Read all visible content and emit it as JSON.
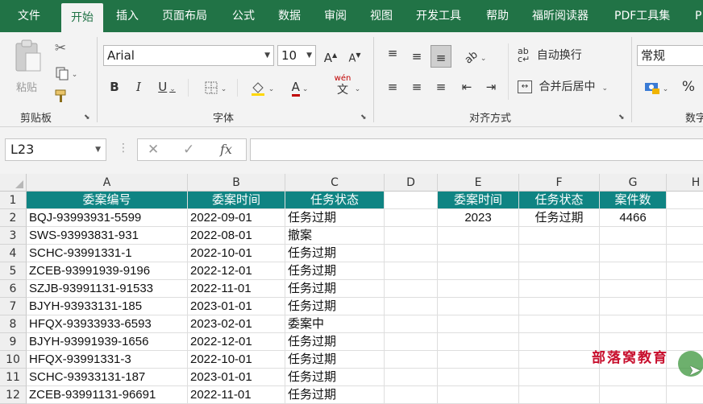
{
  "menu": {
    "items": [
      "文件",
      "开始",
      "插入",
      "页面布局",
      "公式",
      "数据",
      "审阅",
      "视图",
      "开发工具",
      "帮助",
      "福昕阅读器",
      "PDF工具集",
      "P"
    ],
    "active_index": 1
  },
  "ribbon": {
    "clipboard": {
      "paste_label": "粘贴",
      "group_label": "剪贴板"
    },
    "font": {
      "font_name": "Arial",
      "font_size": "10",
      "grow": "A",
      "shrink": "A",
      "bold": "B",
      "italic": "I",
      "underline": "U",
      "font_color": "A",
      "phonetic": "wén",
      "phonetic2": "文",
      "group_label": "字体"
    },
    "alignment": {
      "wrap_text": "自动换行",
      "merge_center": "合并后居中",
      "group_label": "对齐方式"
    },
    "number": {
      "format": "常规",
      "percent": "%",
      "group_label": "数字"
    }
  },
  "formula_bar": {
    "name_box": "L23",
    "fx": "fx",
    "formula": ""
  },
  "grid": {
    "columns": [
      "A",
      "B",
      "C",
      "D",
      "E",
      "F",
      "G",
      "H"
    ],
    "rows": [
      "1",
      "2",
      "3",
      "4",
      "5",
      "6",
      "7",
      "8",
      "9",
      "10",
      "11",
      "12"
    ],
    "header": [
      "委案编号",
      "委案时间",
      "任务状态"
    ],
    "data": [
      [
        "BQJ-93993931-5599",
        "2022-09-01",
        "任务过期"
      ],
      [
        "SWS-93993831-931",
        "2022-08-01",
        "撤案"
      ],
      [
        "SCHC-93991331-1",
        "2022-10-01",
        "任务过期"
      ],
      [
        "ZCEB-93991939-9196",
        "2022-12-01",
        "任务过期"
      ],
      [
        "SZJB-93991131-91533",
        "2022-11-01",
        "任务过期"
      ],
      [
        "BJYH-93933131-185",
        "2023-01-01",
        "任务过期"
      ],
      [
        "HFQX-93933933-6593",
        "2023-02-01",
        "委案中"
      ],
      [
        "BJYH-93991939-1656",
        "2022-12-01",
        "任务过期"
      ],
      [
        "HFQX-93991331-3",
        "2022-10-01",
        "任务过期"
      ],
      [
        "SCHC-93933131-187",
        "2023-01-01",
        "任务过期"
      ],
      [
        "ZCEB-93991131-96691",
        "2022-11-01",
        "任务过期"
      ]
    ],
    "summary_header": [
      "委案时间",
      "任务状态",
      "案件数"
    ],
    "summary_row": [
      "2023",
      "任务过期",
      "4466"
    ]
  },
  "watermark": "部落窝教育",
  "colors": {
    "brand_green": "#217346",
    "header_teal": "#0f8483",
    "watermark_red": "#c8102e"
  }
}
